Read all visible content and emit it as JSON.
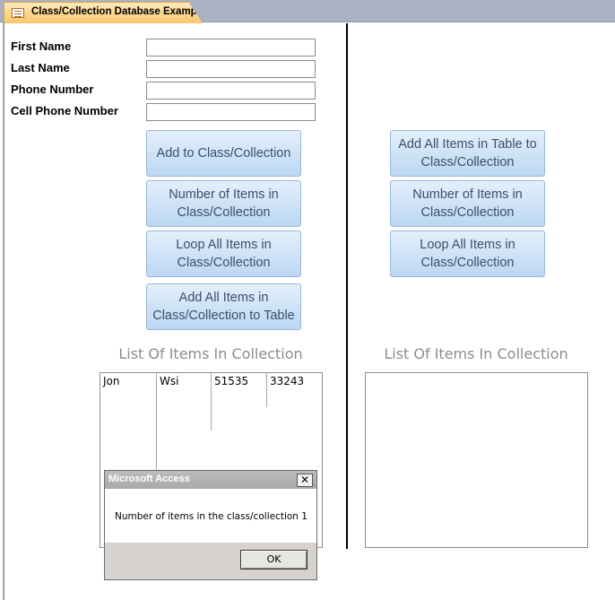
{
  "tab": {
    "title": "Class/Collection Database Example"
  },
  "fields": [
    {
      "label": "First Name",
      "value": ""
    },
    {
      "label": "Last Name",
      "value": ""
    },
    {
      "label": "Phone Number",
      "value": ""
    },
    {
      "label": "Cell Phone Number",
      "value": ""
    }
  ],
  "left_buttons": {
    "add": "Add to Class/Collection",
    "count": "Number of Items in Class/Collection",
    "loop": "Loop All Items in Class/Collection",
    "to_table": "Add All Items in Class/Collection to Table"
  },
  "right_buttons": {
    "add_from_table": "Add All Items in Table to Class/Collection",
    "count": "Number of Items in Class/Collection",
    "loop": "Loop All Items in Class/Collection"
  },
  "left_list": {
    "caption": "List Of Items In Collection",
    "row": [
      "Jon",
      "Wsi",
      "51535",
      "33243"
    ]
  },
  "right_list": {
    "caption": "List Of Items In Collection"
  },
  "dialog": {
    "title": "Microsoft Access",
    "close_glyph": "✕",
    "message": "Number of items in the class/collection 1",
    "ok_label": "OK"
  }
}
